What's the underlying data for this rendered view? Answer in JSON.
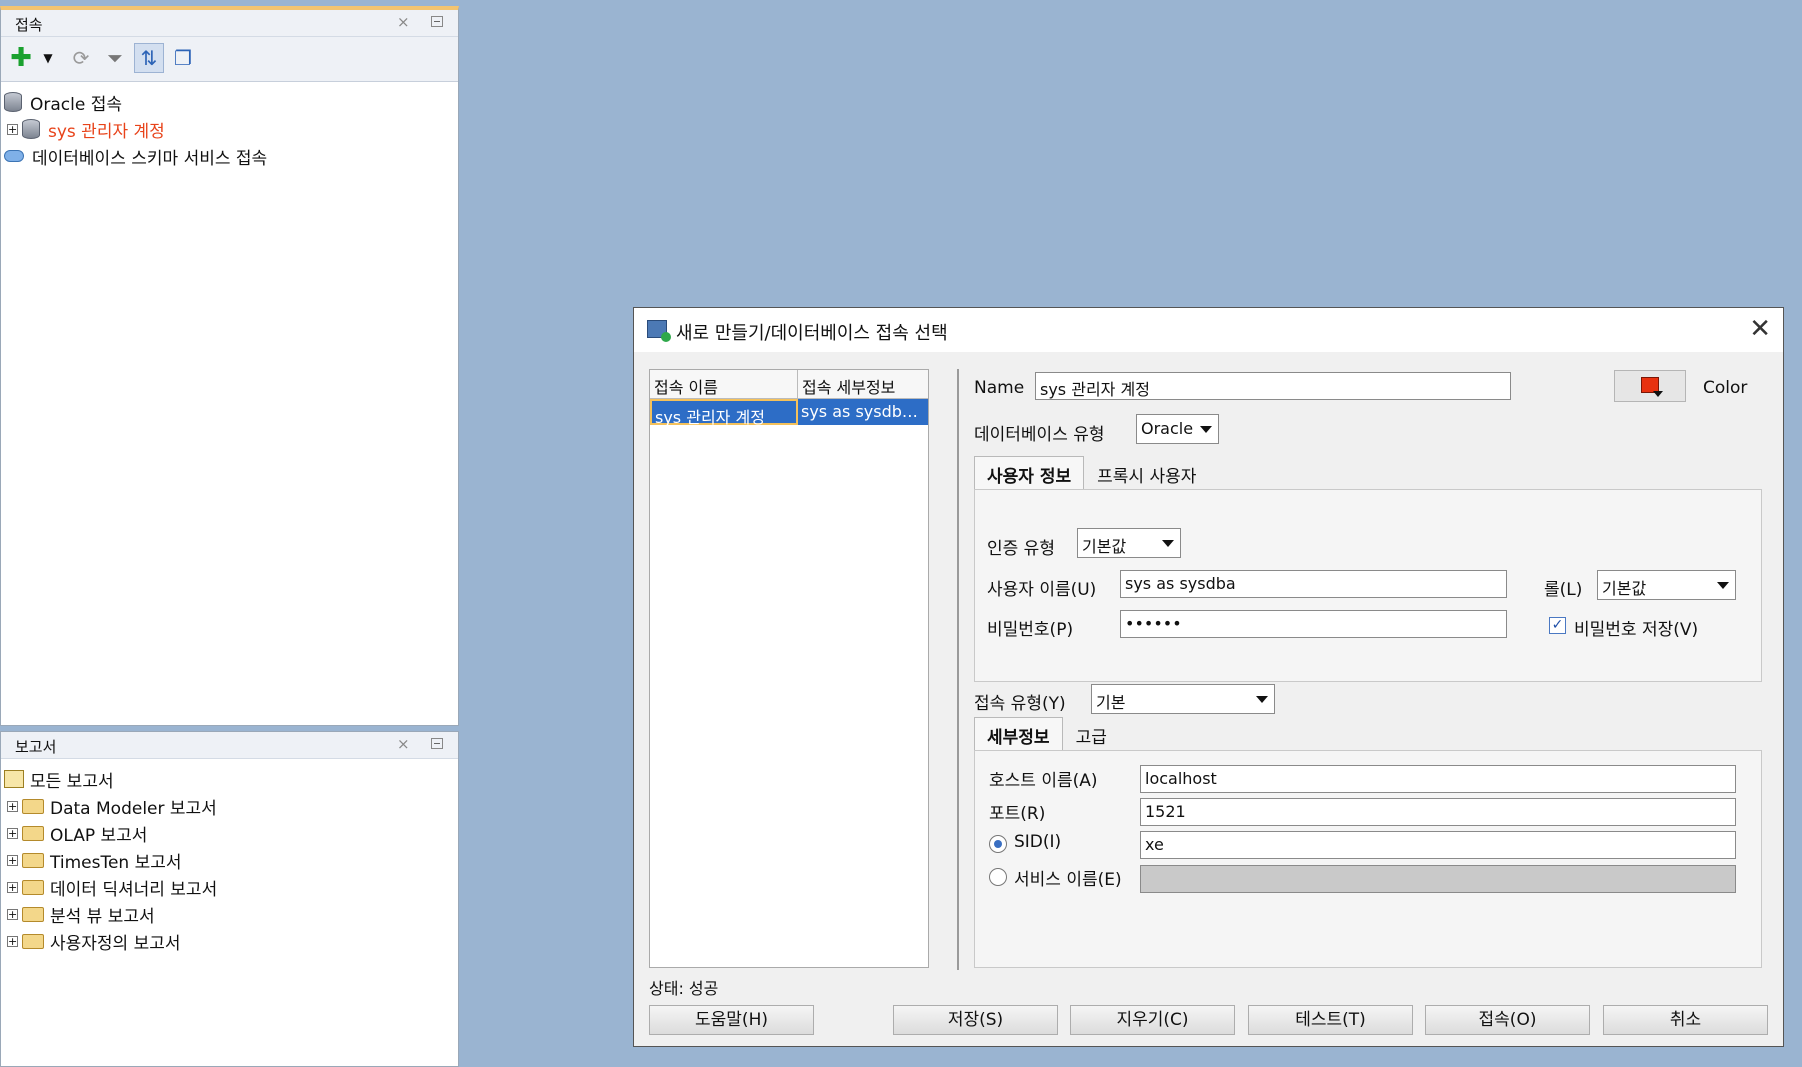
{
  "conn_panel": {
    "title": "접속",
    "close": "×",
    "tree": {
      "root": "Oracle 접속",
      "child": "sys 관리자 계정",
      "cloud": "데이터베이스 스키마 서비스 접속"
    }
  },
  "report_panel": {
    "title": "보고서",
    "close": "×",
    "root": "모든 보고서",
    "items": [
      "Data Modeler 보고서",
      "OLAP 보고서",
      "TimesTen 보고서",
      "데이터 딕셔너리 보고서",
      "분석 뷰 보고서",
      "사용자정의 보고서"
    ]
  },
  "dialog": {
    "title": "새로 만들기/데이터베이스 접속 선택",
    "close": "✕",
    "list": {
      "col1": "접속 이름",
      "col2": "접속 세부정보",
      "row_name": "sys 관리자 계정",
      "row_detail": "sys as sysdba..."
    },
    "status": "상태: 성공",
    "name_label": "Name",
    "name_value": "sys 관리자 계정",
    "color_label": "Color",
    "dbtype_label": "데이터베이스 유형",
    "dbtype_value": "Oracle",
    "tabs": [
      "사용자 정보",
      "프록시 사용자"
    ],
    "auth_label": "인증 유형",
    "auth_value": "기본값",
    "user_label": "사용자 이름(U)",
    "user_value": "sys as sysdba",
    "role_label": "롤(L)",
    "role_value": "기본값",
    "pwd_label": "비밀번호(P)",
    "pwd_value": "••••••",
    "save_pwd_label": "비밀번호 저장(V)",
    "save_pwd_checked": true,
    "conn_type_label": "접속 유형(Y)",
    "conn_type_value": "기본",
    "detail_tabs": [
      "세부정보",
      "고급"
    ],
    "host_label": "호스트 이름(A)",
    "host_value": "localhost",
    "port_label": "포트(R)",
    "port_value": "1521",
    "sid_label": "SID(I)",
    "sid_value": "xe",
    "service_label": "서비스 이름(E)",
    "service_value": "",
    "buttons": {
      "help": "도움말(H)",
      "save": "저장(S)",
      "clear": "지우기(C)",
      "test": "테스트(T)",
      "connect": "접속(O)",
      "cancel": "취소"
    }
  }
}
